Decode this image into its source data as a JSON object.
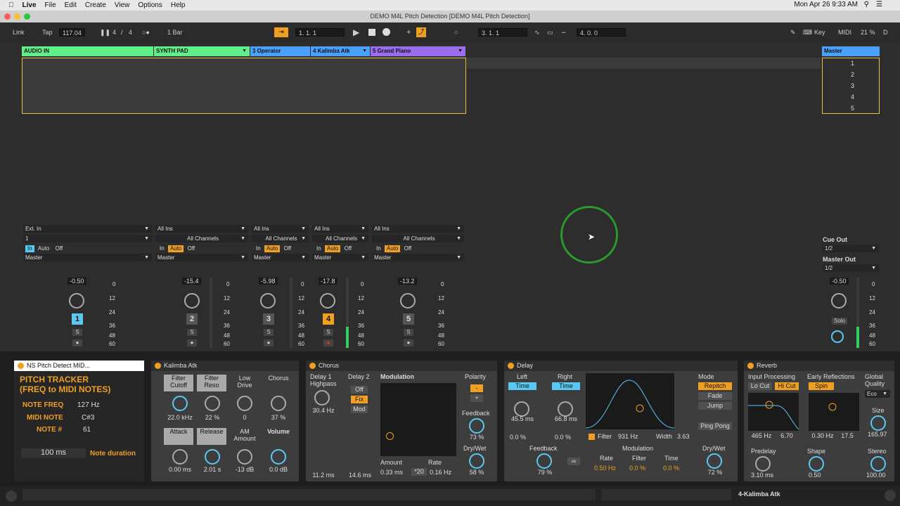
{
  "menubar": {
    "app": "Live",
    "items": [
      "File",
      "Edit",
      "Create",
      "View",
      "Options",
      "Help"
    ],
    "clock": "Mon Apr 26  9:33 AM"
  },
  "window_title": "DEMO M4L Pitch Detection  [DEMO M4L Pitch Detection]",
  "transport": {
    "link": "Link",
    "tap": "Tap",
    "tempo": "117.04",
    "sig_num": "4",
    "sig_den": "4",
    "quant": "1 Bar",
    "pos": "1.   1.   1",
    "loop_start": "3.   1.   1",
    "loop_len": "4.   0.   0",
    "key": "Key",
    "midi": "MIDI",
    "cpu": "21 %",
    "d": "D"
  },
  "tracks": [
    {
      "name": "AUDIO IN",
      "color": "#5ff08a",
      "input": "Ext. In",
      "channel": "1",
      "out": "Master",
      "vol": "-0.50",
      "num": "1",
      "numcolor": "#5ac8f0",
      "auto": false
    },
    {
      "name": "SYNTH PAD",
      "color": "#5ff08a",
      "input": "All Ins",
      "channel": "All Channels",
      "out": "Master",
      "vol": "-15.4",
      "num": "2",
      "numcolor": "#555",
      "auto": true
    },
    {
      "name": "3 Operator",
      "color": "#4aa0ff",
      "input": "All Ins",
      "channel": "All Channels",
      "out": "Master",
      "vol": "-5.98",
      "num": "3",
      "numcolor": "#555",
      "auto": true
    },
    {
      "name": "4 Kalimba Atk",
      "color": "#4aa0ff",
      "input": "All Ins",
      "channel": "All Channels",
      "out": "Master",
      "vol": "-17.8",
      "num": "4",
      "numcolor": "#f0a020",
      "auto": true
    },
    {
      "name": "5 Grand Piano",
      "color": "#9a6cf0",
      "input": "All Ins",
      "channel": "All Channels",
      "out": "Master",
      "vol": "-13.2",
      "num": "5",
      "numcolor": "#555",
      "auto": true
    }
  ],
  "io_labels": {
    "in": "In",
    "auto": "Auto",
    "off": "Off"
  },
  "db_scale": [
    "0",
    "12",
    "24",
    "36",
    "48",
    "60"
  ],
  "master": {
    "name": "Master",
    "scenes": [
      "1",
      "2",
      "3",
      "4",
      "5"
    ],
    "cue_label": "Cue Out",
    "cue": "1/2",
    "out_label": "Master Out",
    "out": "1/2",
    "vol": "-0.50",
    "solo": "Solo"
  },
  "pitch": {
    "title": "NS Pitch Detect MID...",
    "heading": "PITCH TRACKER\n(FREQ to MIDI NOTES)",
    "rows": [
      {
        "k": "NOTE FREQ",
        "v": "127 Hz"
      },
      {
        "k": "MIDI NOTE",
        "v": "C#3"
      },
      {
        "k": "NOTE #",
        "v": "61"
      }
    ],
    "duration": "100 ms",
    "duration_label": "Note duration"
  },
  "kalimba": {
    "title": "Kalimba Atk",
    "knobs": [
      {
        "l": "Filter\nCutoff",
        "v": "22.0 kHz"
      },
      {
        "l": "Filter\nReso",
        "v": "22 %"
      },
      {
        "l": "Low\nDrive",
        "v": "0"
      },
      {
        "l": "Chorus",
        "v": "37 %"
      },
      {
        "l": "Attack",
        "v": "0.00 ms"
      },
      {
        "l": "Release",
        "v": "2.01 s"
      },
      {
        "l": "AM\nAmount",
        "v": "-13 dB"
      },
      {
        "l": "Volume",
        "v": "0.0 dB"
      }
    ]
  },
  "chorus": {
    "title": "Chorus",
    "d1": "Delay 1\nHighpass",
    "d1v": "30.4 Hz",
    "d2": "Delay 2",
    "off": "Off",
    "fix": "Fix",
    "mod": "Mod",
    "d1ms": "11.2 ms",
    "d2ms": "14.6 ms",
    "modulation": "Modulation",
    "amount": "Amount",
    "amountv": "0.33 ms",
    "x20": "*20",
    "rate": "Rate",
    "ratev": "0.16 Hz",
    "polarity": "Polarity",
    "feedback": "Feedback",
    "fbv": "73 %",
    "drywet": "Dry/Wet",
    "dwv": "58 %"
  },
  "delay": {
    "title": "Delay",
    "left": "Left",
    "right": "Right",
    "time": "Time",
    "lv": "45.5 ms",
    "rv": "66.8 ms",
    "lp": "0.0 %",
    "rp": "0.0 %",
    "feedback": "Feedback",
    "fbv": "79 %",
    "filter": "Filter",
    "filterv": "931 Hz",
    "width": "Width",
    "widthv": "3.63",
    "modulation": "Modulation",
    "rate": "Rate",
    "ratev": "0.50 Hz",
    "mfilter": "Filter",
    "mfilterv": "0.0 %",
    "mtime": "Time",
    "mtimev": "0.0 %",
    "mode": "Mode",
    "repitch": "Repitch",
    "fade": "Fade",
    "jump": "Jump",
    "pingpong": "Ping Pong",
    "drywet": "Dry/Wet",
    "dwv": "72 %"
  },
  "reverb": {
    "title": "Reverb",
    "input": "Input Processing",
    "locut": "Lo Cut",
    "hicut": "Hi Cut",
    "early": "Early Reflections",
    "spin": "Spin",
    "global": "Global\nQuality",
    "eco": "Eco",
    "f1": "465 Hz",
    "f2": "6.70",
    "s1": "0.30 Hz",
    "s2": "17.5",
    "size": "Size",
    "sizev": "165.97",
    "predelay": "Predelay",
    "predelayv": "3.10 ms",
    "shape": "Shape",
    "shapev": "0.50",
    "stereo": "Stereo",
    "stereov": "100.00"
  },
  "status": {
    "selected": "4-Kalimba Atk"
  }
}
